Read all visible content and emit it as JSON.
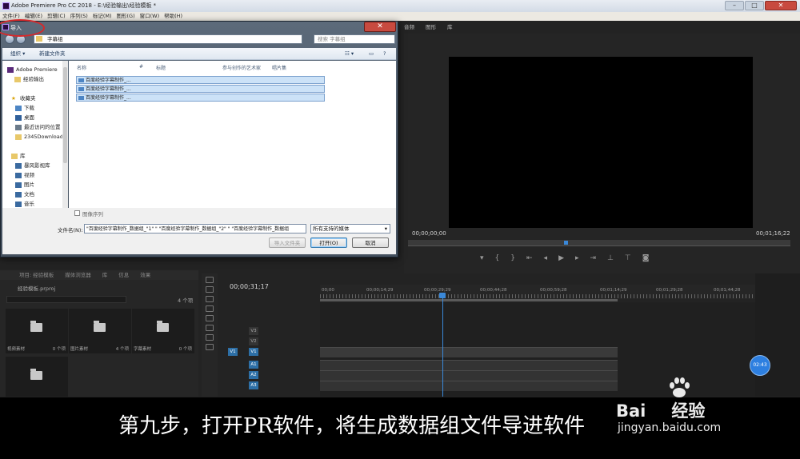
{
  "window": {
    "title": "Adobe Premiere Pro CC 2018 - E:\\经验输出\\经验模板 *"
  },
  "menu": [
    "文件(F)",
    "编辑(E)",
    "剪辑(C)",
    "序列(S)",
    "标记(M)",
    "图形(G)",
    "窗口(W)",
    "帮助(H)"
  ],
  "program": {
    "tabs": [
      "音频",
      "图形",
      "库"
    ],
    "tc_left": "00;00;00;00",
    "tc_right": "00;01;16;22"
  },
  "project": {
    "tabs": [
      "项目: 经验模板",
      "媒体浏览器",
      "库",
      "信息",
      "效果"
    ],
    "file": "经验模板.prproj",
    "count": "4 个项",
    "bins": [
      {
        "name": "视频素材",
        "count": "0 个项"
      },
      {
        "name": "图片素材",
        "count": "4 个项"
      },
      {
        "name": "字幕素材",
        "count": "0 个项"
      },
      {
        "name": "",
        "count": ""
      }
    ]
  },
  "timeline": {
    "timecode": "00;00;31;17",
    "ruler": [
      "00;00",
      "00;00;14;29",
      "00;00;29;29",
      "00;00;44;28",
      "00;00;59;28",
      "00;01;14;29",
      "00;01;29;28",
      "00;01;44;28"
    ],
    "tracks": [
      "V3",
      "V2",
      "V1",
      "A1",
      "A2",
      "A3"
    ],
    "source_label": "V1",
    "playback_time": "02:43"
  },
  "dialog": {
    "title": "导入",
    "path": "字幕组",
    "search_placeholder": "搜索 字幕组",
    "toolbar": {
      "organize": "组织 ▾",
      "new_folder": "新建文件夹"
    },
    "nav": [
      "Adobe Premiere",
      "经验输出",
      "收藏夹",
      "下载",
      "桌面",
      "最近访问的位置",
      "2345Downloads",
      "库",
      "暴风影视库",
      "视频",
      "图片",
      "文档",
      "音乐"
    ],
    "columns": [
      "名称",
      "#",
      "标题",
      "参与创作的艺术家",
      "唱片集"
    ],
    "files": [
      "百度经验字幕制作_...",
      "百度经验字幕制作_...",
      "百度经验字幕制作_..."
    ],
    "image_sequence": "图像序列",
    "filename_label": "文件名(N):",
    "filename_value": "\"百度经验字幕制作_数据组_\"1\" \" \"百度经验字幕制作_数据组_\"2\" \" \"百度经验字幕制作_数据组",
    "filetype": "所有支持的媒体",
    "buttons": {
      "import_folder": "导入文件夹",
      "open": "打开(O)",
      "cancel": "取消"
    }
  },
  "subtitle": "第九步，打开PR软件，将生成数据组文件导进软件",
  "watermark": {
    "brand_a": "Bai",
    "brand_b": "经验",
    "url": "jingyan.baidu.com"
  }
}
